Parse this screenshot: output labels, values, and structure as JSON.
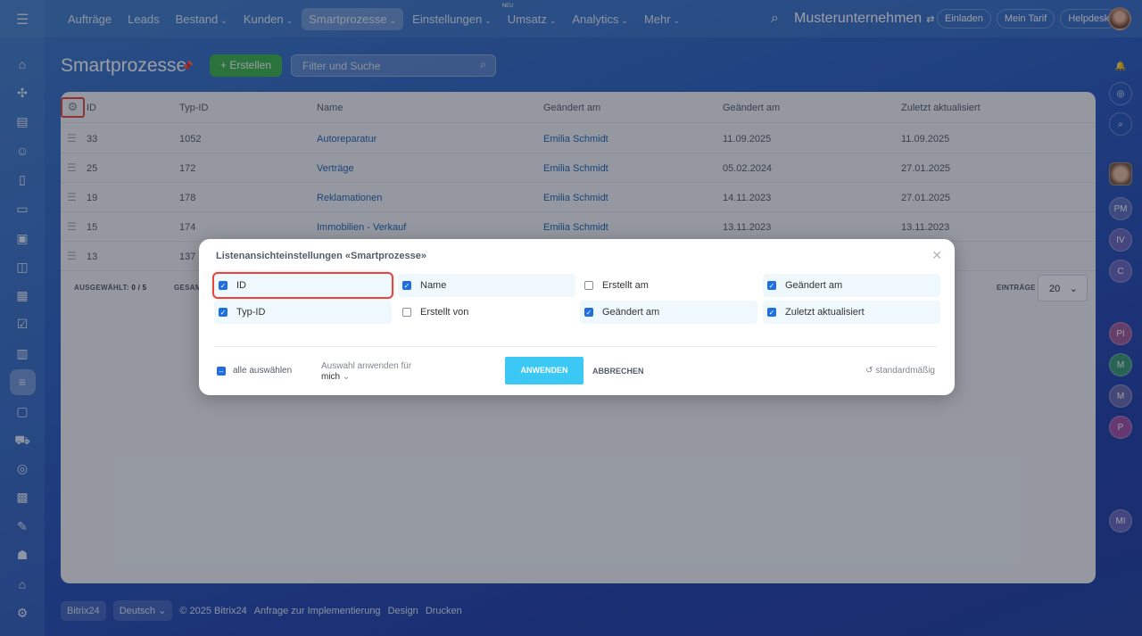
{
  "topbar": {
    "nav": [
      {
        "label": "Aufträge",
        "chev": false
      },
      {
        "label": "Leads",
        "chev": false
      },
      {
        "label": "Bestand",
        "chev": true
      },
      {
        "label": "Kunden",
        "chev": true
      },
      {
        "label": "Smartprozesse",
        "chev": true,
        "active": true
      },
      {
        "label": "Einstellungen",
        "chev": true
      },
      {
        "label": "Umsatz",
        "chev": true,
        "badge": "NEU"
      },
      {
        "label": "Analytics",
        "chev": true
      },
      {
        "label": "Mehr",
        "chev": true
      }
    ],
    "company": "Musterunternehmen",
    "invite": "Einladen",
    "tariff": "Mein Tarif",
    "helpdesk": "Helpdesk"
  },
  "page": {
    "title": "Smartprozesse",
    "create": "Erstellen",
    "search_placeholder": "Filter und Suche"
  },
  "table": {
    "headers": [
      "ID",
      "Typ-ID",
      "Name",
      "Geändert am",
      "Geändert am",
      "Zuletzt aktualisiert"
    ],
    "rows": [
      [
        "33",
        "1052",
        "Autoreparatur",
        "Emilia Schmidt",
        "11.09.2025",
        "11.09.2025"
      ],
      [
        "25",
        "172",
        "Verträge",
        "Emilia Schmidt",
        "05.02.2024",
        "27.01.2025"
      ],
      [
        "19",
        "178",
        "Reklamationen",
        "Emilia Schmidt",
        "14.11.2023",
        "27.01.2025"
      ],
      [
        "15",
        "174",
        "Immobilien - Verkauf",
        "Emilia Schmidt",
        "13.11.2023",
        "13.11.2023"
      ],
      [
        "13",
        "137",
        "",
        "",
        "",
        ""
      ]
    ],
    "selected_label": "AUSGEWÄHLT:",
    "selected_value": "0 / 5",
    "total_label": "GESAM",
    "per_page_label": "EINTRÄGE",
    "per_page": "20"
  },
  "right_bar": [
    "PM",
    "IV",
    "C",
    "PI",
    "M",
    "M",
    "P",
    "MI"
  ],
  "footer": {
    "brand": "Bitrix24",
    "lang": "Deutsch",
    "copyright": "© 2025 Bitrix24",
    "impl": "Anfrage zur Implementierung",
    "design": "Design",
    "print": "Drucken"
  },
  "modal": {
    "title": "Listenansichteinstellungen «Smartprozesse»",
    "options": [
      {
        "label": "ID",
        "checked": true
      },
      {
        "label": "Name",
        "checked": true
      },
      {
        "label": "Erstellt am",
        "checked": false
      },
      {
        "label": "Geändert am",
        "checked": true
      },
      {
        "label": "Typ-ID",
        "checked": true
      },
      {
        "label": "Erstellt von",
        "checked": false
      },
      {
        "label": "Geändert am",
        "checked": true
      },
      {
        "label": "Zuletzt aktualisiert",
        "checked": true
      }
    ],
    "select_all": "alle auswählen",
    "apply_for": "Auswahl anwenden für",
    "apply_for_value": "mich",
    "apply": "ANWENDEN",
    "cancel": "ABBRECHEN",
    "reset": "standardmäßig"
  },
  "colors": {
    "accent": "#3bc8f5",
    "create": "#3bb54a",
    "highlight": "#e8453c"
  }
}
